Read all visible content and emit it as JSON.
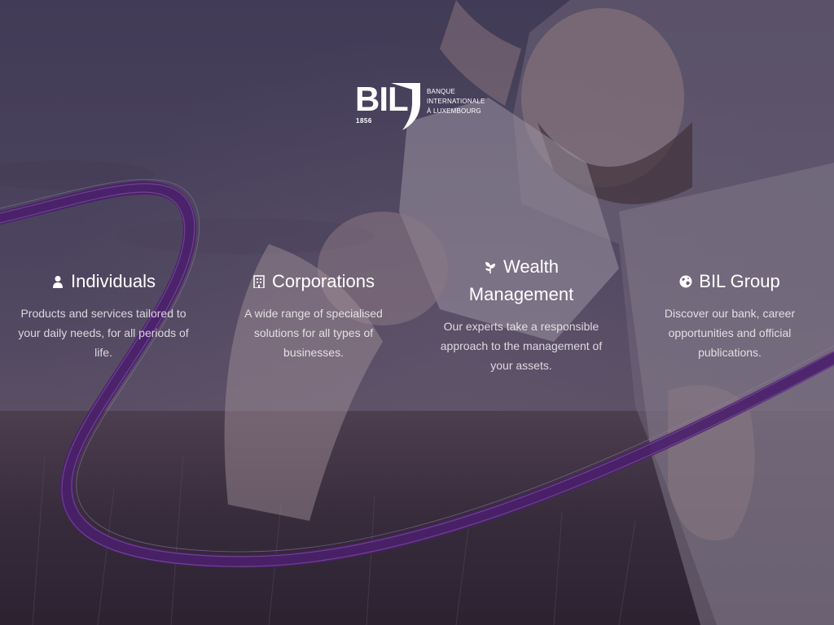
{
  "logo": {
    "brand": "BIL",
    "year": "1856",
    "line1": "BANQUE",
    "line2": "INTERNATIONALE",
    "line3": "À LUXEMBOURG"
  },
  "sections": [
    {
      "icon": "user-icon",
      "title": "Individuals",
      "description": "Products and services tailored to your daily needs, for all periods of life."
    },
    {
      "icon": "building-icon",
      "title": "Corporations",
      "description": "A wide range of specialised solutions for all types of businesses."
    },
    {
      "icon": "leaf-icon",
      "title": "Wealth Management",
      "description": "Our experts take a responsible approach to the management of your assets."
    },
    {
      "icon": "globe-icon",
      "title": "BIL Group",
      "description": "Discover our bank, career opportunities and official publications."
    }
  ],
  "colors": {
    "ribbon": "#4a1f6b",
    "ribbon_highlight": "#7a4a9a",
    "text": "#ffffff"
  }
}
